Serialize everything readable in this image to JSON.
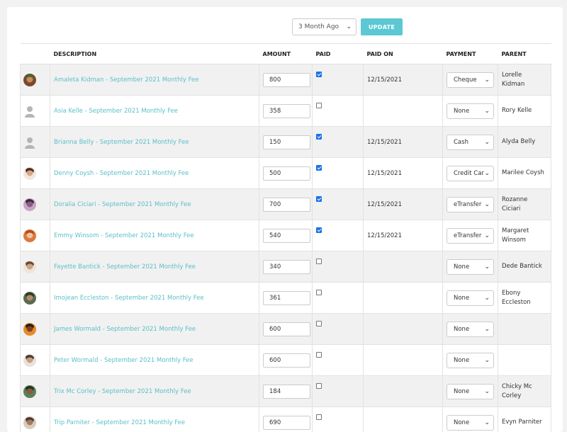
{
  "toolbar": {
    "period_value": "3 Month Ago",
    "update_label": "UPDATE"
  },
  "table": {
    "headers": {
      "description": "DESCRIPTION",
      "amount": "AMOUNT",
      "paid": "PAID",
      "paid_on": "PAID ON",
      "payment": "PAYMENT",
      "parent": "PARENT"
    },
    "rows": [
      {
        "description": "Amaleta Kidman - September 2021 Monthly Fee",
        "amount": "800",
        "paid": true,
        "paid_on": "12/15/2021",
        "payment": "Cheque",
        "parent": "Lorelle Kidman",
        "avatar": "photo-avatar-1"
      },
      {
        "description": "Asia Kelle - September 2021 Monthly Fee",
        "amount": "358",
        "paid": false,
        "paid_on": "",
        "payment": "None",
        "parent": "Rory Kelle",
        "avatar": "default-avatar"
      },
      {
        "description": "Brianna Belly - September 2021 Monthly Fee",
        "amount": "150",
        "paid": true,
        "paid_on": "12/15/2021",
        "payment": "Cash",
        "parent": "Alyda Belly",
        "avatar": "default-avatar"
      },
      {
        "description": "Denny Coysh - September 2021 Monthly Fee",
        "amount": "500",
        "paid": true,
        "paid_on": "12/15/2021",
        "payment": "Credit Card",
        "parent": "Marilee Coysh",
        "avatar": "photo-avatar-2"
      },
      {
        "description": "Doralia Ciciari - September 2021 Monthly Fee",
        "amount": "700",
        "paid": true,
        "paid_on": "12/15/2021",
        "payment": "eTransfer",
        "parent": "Rozanne Ciciari",
        "avatar": "photo-avatar-3"
      },
      {
        "description": "Emmy Winsom - September 2021 Monthly Fee",
        "amount": "540",
        "paid": true,
        "paid_on": "12/15/2021",
        "payment": "eTransfer",
        "parent": "Margaret Winsom",
        "avatar": "photo-avatar-4"
      },
      {
        "description": "Fayette Bantick - September 2021 Monthly Fee",
        "amount": "340",
        "paid": false,
        "paid_on": "",
        "payment": "None",
        "parent": "Dede Bantick",
        "avatar": "photo-avatar-5"
      },
      {
        "description": "Imojean Eccleston - September 2021 Monthly Fee",
        "amount": "361",
        "paid": false,
        "paid_on": "",
        "payment": "None",
        "parent": "Ebony Eccleston",
        "avatar": "photo-avatar-6"
      },
      {
        "description": "James Wormald - September 2021 Monthly Fee",
        "amount": "600",
        "paid": false,
        "paid_on": "",
        "payment": "None",
        "parent": "",
        "avatar": "photo-avatar-7"
      },
      {
        "description": "Peter Wormald - September 2021 Monthly Fee",
        "amount": "600",
        "paid": false,
        "paid_on": "",
        "payment": "None",
        "parent": "",
        "avatar": "photo-avatar-8"
      },
      {
        "description": "Trix Mc Corley - September 2021 Monthly Fee",
        "amount": "184",
        "paid": false,
        "paid_on": "",
        "payment": "None",
        "parent": "Chicky Mc Corley",
        "avatar": "photo-avatar-9"
      },
      {
        "description": "Trip Parniter - September 2021 Monthly Fee",
        "amount": "690",
        "paid": false,
        "paid_on": "",
        "payment": "None",
        "parent": "Evyn Parniter",
        "avatar": "photo-avatar-10"
      }
    ]
  },
  "colors": {
    "accent": "#5bc8d4",
    "link": "#5bbfc8",
    "checkbox_checked": "#1a73e8"
  }
}
